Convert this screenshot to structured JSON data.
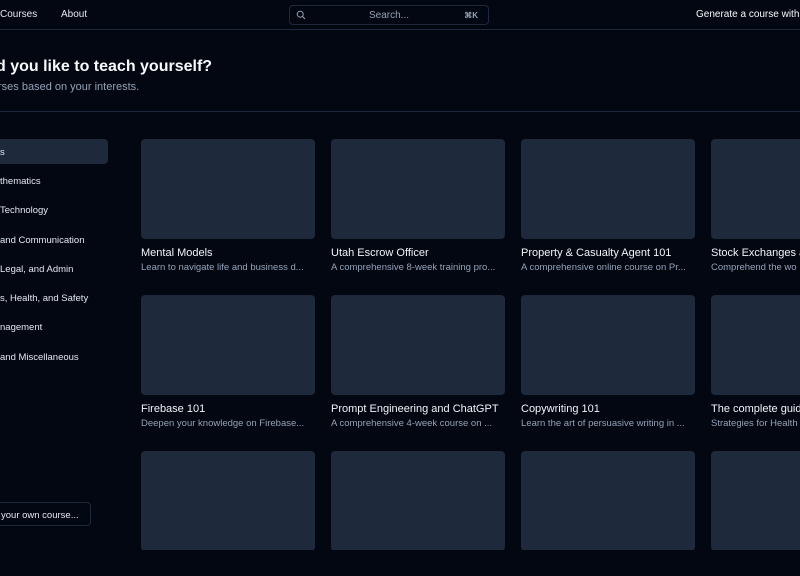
{
  "nav": {
    "courses_label": "Courses",
    "about_label": "About",
    "search_placeholder": "Search...",
    "search_shortcut": "⌘K",
    "generate_label": "Generate a course with"
  },
  "hero": {
    "title": "d you like to teach yourself?",
    "subtitle": "rses based on your interests."
  },
  "categories": [
    "s",
    "thematics",
    "Technology",
    "and Communication",
    "Legal, and Admin",
    "s, Health, and Safety",
    "nagement",
    "and Miscellaneous"
  ],
  "create_own_label": "your own course...",
  "courses": [
    {
      "title": "Mental Models",
      "desc": "Learn to navigate life and business d..."
    },
    {
      "title": "Utah Escrow Officer",
      "desc": "A comprehensive 8-week training pro..."
    },
    {
      "title": "Property & Casualty Agent 101",
      "desc": "A comprehensive online course on Pr..."
    },
    {
      "title": "Stock Exchanges a",
      "desc": "Comprehend the wo"
    },
    {
      "title": "Firebase 101",
      "desc": "Deepen your knowledge on Firebase..."
    },
    {
      "title": "Prompt Engineering and ChatGPT",
      "desc": "A comprehensive 4-week course on ..."
    },
    {
      "title": "Copywriting 101",
      "desc": "Learn the art of persuasive writing in ..."
    },
    {
      "title": "The complete guid",
      "desc": "Strategies for Health"
    },
    {
      "title": "",
      "desc": ""
    },
    {
      "title": "",
      "desc": ""
    },
    {
      "title": "",
      "desc": ""
    },
    {
      "title": "",
      "desc": ""
    }
  ]
}
